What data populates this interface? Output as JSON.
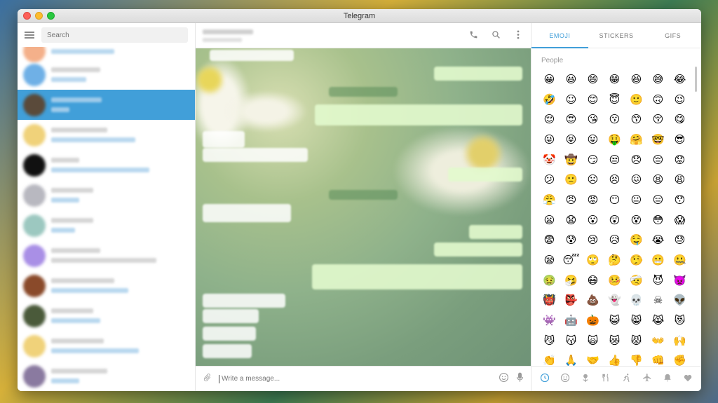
{
  "window": {
    "title": "Telegram"
  },
  "sidebar": {
    "search_placeholder": "Search"
  },
  "composer": {
    "placeholder": "Write a message..."
  },
  "panel": {
    "tabs": [
      "EMOJI",
      "STICKERS",
      "GIFS"
    ],
    "active_tab": "EMOJI",
    "section_title": "People",
    "emojis": [
      "😀",
      "😃",
      "😄",
      "😁",
      "😆",
      "😅",
      "😂",
      "🤣",
      "☺",
      "😊",
      "😇",
      "🙂",
      "🙃",
      "😉",
      "😌",
      "😍",
      "😘",
      "😗",
      "😙",
      "😚",
      "😋",
      "😜",
      "😝",
      "😛",
      "🤑",
      "🤗",
      "🤓",
      "😎",
      "🤡",
      "🤠",
      "😏",
      "😒",
      "😞",
      "😔",
      "😟",
      "😕",
      "🙁",
      "☹",
      "😣",
      "😖",
      "😫",
      "😩",
      "😤",
      "😠",
      "😡",
      "😶",
      "😐",
      "😑",
      "😯",
      "😦",
      "😧",
      "😮",
      "😲",
      "😵",
      "😳",
      "😱",
      "😨",
      "😰",
      "😢",
      "😥",
      "🤤",
      "😭",
      "😓",
      "😪",
      "😴",
      "🙄",
      "🤔",
      "🤥",
      "😬",
      "🤐",
      "🤢",
      "🤧",
      "😷",
      "🤒",
      "🤕",
      "😈",
      "👿",
      "👹",
      "👺",
      "💩",
      "👻",
      "💀",
      "☠",
      "👽",
      "👾",
      "🤖",
      "🎃",
      "😺",
      "😸",
      "😹",
      "😻",
      "😼",
      "😽",
      "🙀",
      "😿",
      "😾",
      "👐",
      "🙌",
      "👏",
      "🙏",
      "🤝",
      "👍",
      "👎",
      "👊",
      "✊"
    ],
    "category_icons": [
      "clock-icon",
      "smiley-icon",
      "nature-icon",
      "food-icon",
      "activity-icon",
      "travel-icon",
      "objects-icon",
      "symbols-icon"
    ]
  },
  "colors": {
    "accent": "#419fd9",
    "active_chat": "#419fd9"
  }
}
